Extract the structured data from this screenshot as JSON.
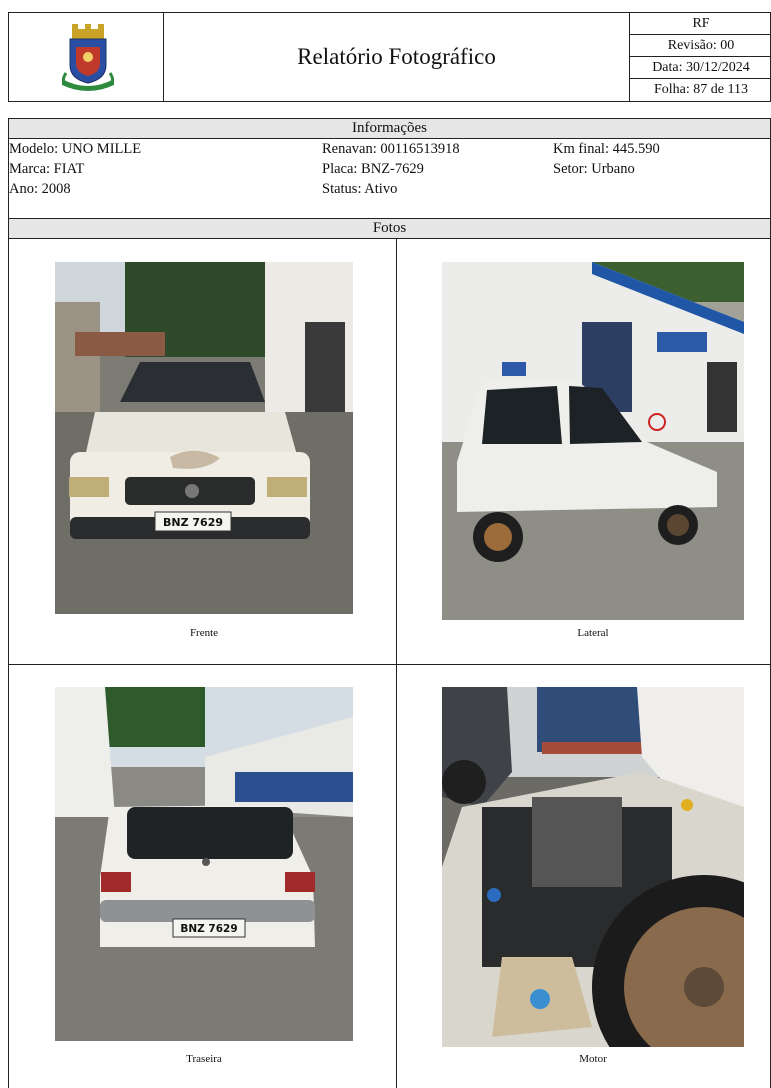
{
  "header": {
    "title": "Relatório Fotográfico",
    "code": "RF",
    "revision": "Revisão: 00",
    "date": "Data: 30/12/2024",
    "sheet": "Folha: 87 de 113",
    "logo_icon": "municipal-coat-of-arms"
  },
  "info": {
    "heading": "Informações",
    "modelo": "Modelo: UNO MILLE",
    "marca": "Marca: FIAT",
    "ano": "Ano: 2008",
    "renavan": "Renavan: 00116513918",
    "placa": "Placa: BNZ-7629",
    "status": "Status: Ativo",
    "km_final": "Km final: 445.590",
    "setor": "Setor: Urbano"
  },
  "photos": {
    "heading": "Fotos",
    "captions": [
      "Frente",
      "Lateral",
      "Traseira",
      "Motor"
    ],
    "plate_text": "BNZ 7629"
  }
}
